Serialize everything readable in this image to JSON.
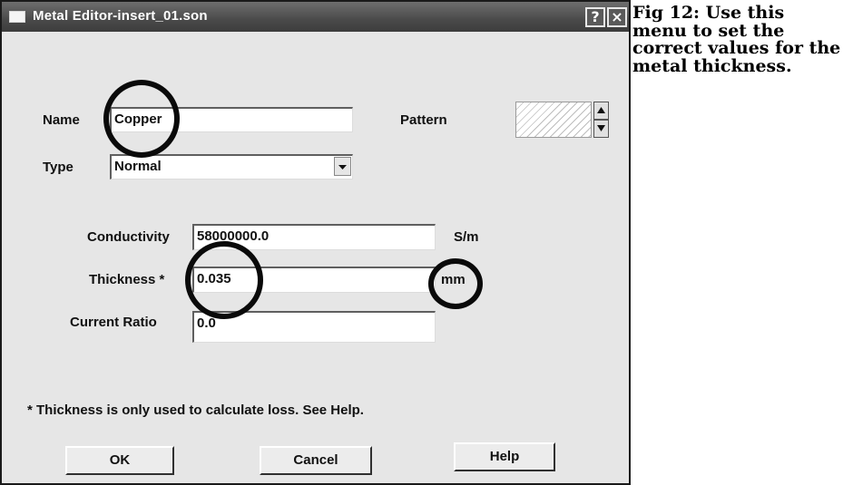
{
  "window": {
    "title": "Metal Editor-insert_01.son",
    "help_glyph": "?",
    "close_glyph": "×"
  },
  "form": {
    "name_label": "Name",
    "name_value": "Copper",
    "pattern_label": "Pattern",
    "type_label": "Type",
    "type_value": "Normal",
    "conductivity_label": "Conductivity",
    "conductivity_value": "58000000.0",
    "conductivity_unit": "S/m",
    "thickness_label": "Thickness *",
    "thickness_value": "0.035",
    "thickness_unit": "mm",
    "current_ratio_label": "Current Ratio",
    "current_ratio_value": "0.0",
    "footnote": "* Thickness is only used to calculate loss. See Help."
  },
  "buttons": {
    "ok": "OK",
    "cancel": "Cancel",
    "help": "Help"
  },
  "caption": "Fig 12: Use this menu to set the correct values for the metal thickness."
}
